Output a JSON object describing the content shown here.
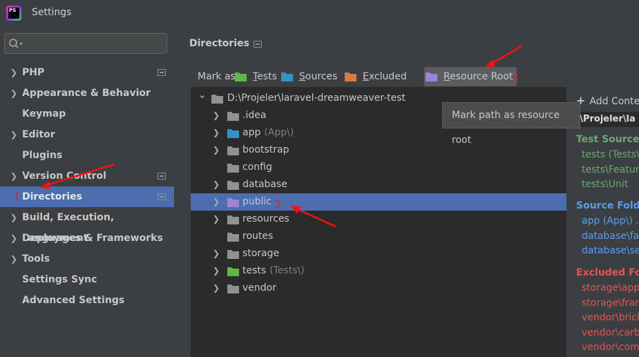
{
  "window": {
    "title": "Settings",
    "app_icon_text": "PS"
  },
  "search": {
    "value": ""
  },
  "sidebar": {
    "items": [
      {
        "label": "PHP",
        "expandable": true,
        "project_icon": true
      },
      {
        "label": "Appearance & Behavior",
        "expandable": true,
        "project_icon": false
      },
      {
        "label": "Keymap",
        "expandable": false,
        "project_icon": false
      },
      {
        "label": "Editor",
        "expandable": true,
        "project_icon": false
      },
      {
        "label": "Plugins",
        "expandable": false,
        "project_icon": false
      },
      {
        "label": "Version Control",
        "expandable": true,
        "project_icon": true
      },
      {
        "label": "Directories",
        "expandable": false,
        "project_icon": true,
        "selected": true
      },
      {
        "label": "Build, Execution, Deployment",
        "expandable": true,
        "project_icon": false
      },
      {
        "label": "Languages & Frameworks",
        "expandable": true,
        "project_icon": false
      },
      {
        "label": "Tools",
        "expandable": true,
        "project_icon": false
      },
      {
        "label": "Settings Sync",
        "expandable": false,
        "project_icon": false
      },
      {
        "label": "Advanced Settings",
        "expandable": false,
        "project_icon": false
      }
    ]
  },
  "main": {
    "title": "Directories",
    "mark_as": {
      "label": "Mark as:",
      "buttons": [
        {
          "label": "Tests",
          "mnemonic": "T",
          "rest": "ests",
          "color": "#62b543"
        },
        {
          "label": "Sources",
          "mnemonic": "S",
          "rest": "ources",
          "color": "#3592c4"
        },
        {
          "label": "Excluded",
          "mnemonic": "E",
          "rest": "xcluded",
          "color": "#db7a3c"
        },
        {
          "label": "Resource Root",
          "mnemonic": "R",
          "rest": "esource Root",
          "color": "#9e84d4"
        }
      ]
    },
    "tooltip": "Mark path as resource root",
    "tree": {
      "root": "D:\\Projeler\\laravel-dreamweaver-test",
      "children": [
        {
          "name": ".idea",
          "suffix": "",
          "expandable": true,
          "color": "#8e9295"
        },
        {
          "name": "app",
          "suffix": "(App\\)",
          "expandable": true,
          "color": "#3592c4"
        },
        {
          "name": "bootstrap",
          "suffix": "",
          "expandable": true,
          "color": "#8e9295"
        },
        {
          "name": "config",
          "suffix": "",
          "expandable": false,
          "color": "#8e9295"
        },
        {
          "name": "database",
          "suffix": "",
          "expandable": true,
          "color": "#8e9295"
        },
        {
          "name": "public",
          "suffix": "",
          "expandable": true,
          "color": "#9e84d4",
          "selected": true
        },
        {
          "name": "resources",
          "suffix": "",
          "expandable": true,
          "color": "#8e9295"
        },
        {
          "name": "routes",
          "suffix": "",
          "expandable": false,
          "color": "#8e9295"
        },
        {
          "name": "storage",
          "suffix": "",
          "expandable": true,
          "color": "#8e9295"
        },
        {
          "name": "tests",
          "suffix": "(Tests\\)",
          "expandable": true,
          "color": "#62b543"
        },
        {
          "name": "vendor",
          "suffix": "",
          "expandable": true,
          "color": "#8e9295"
        }
      ]
    },
    "content_panel": {
      "add_content_root": "Add Conte",
      "root_path": ":\\Projeler\\la",
      "test_sources": {
        "title": "Test Source F",
        "items": [
          "tests (Tests\\)",
          "tests\\Feature",
          "tests\\Unit"
        ]
      },
      "source_folders": {
        "title": "Source Folder",
        "items": [
          "app (App\\) .",
          "database\\fac",
          "database\\sec"
        ]
      },
      "excluded_folders": {
        "title": "Excluded Fold",
        "items": [
          "storage\\app",
          "storage\\fram",
          "vendor\\brick",
          "vendor\\carbo",
          "vendor\\comp"
        ]
      }
    }
  },
  "annotations": {
    "one": "1",
    "two": "2",
    "three": "3"
  },
  "colors": {
    "selection": "#4b6eaf",
    "annotation": "#ff1010"
  }
}
